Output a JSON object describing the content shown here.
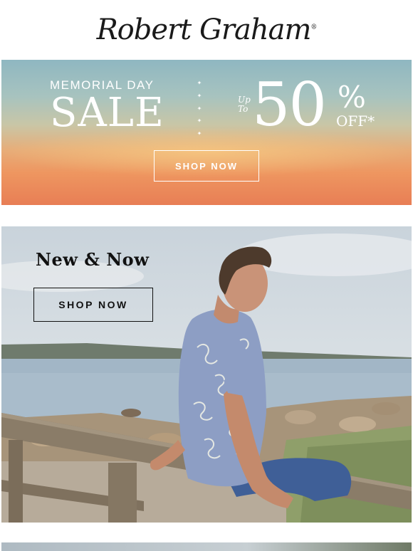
{
  "brand": {
    "logo_text": "Robert Graham",
    "logo_mark": "®"
  },
  "sale_banner": {
    "eyebrow": "MEMORIAL DAY",
    "title": "SALE",
    "up_to": [
      "Up",
      "To"
    ],
    "percent": "50",
    "percent_sign": "%",
    "off": "OFF*",
    "cta_label": "SHOP NOW"
  },
  "hero": {
    "headline": "New & Now",
    "cta_label": "SHOP NOW"
  },
  "colors": {
    "sunset_orange": "#e87e55",
    "sky_teal": "#8fb7c1",
    "text_dark": "#111111"
  }
}
